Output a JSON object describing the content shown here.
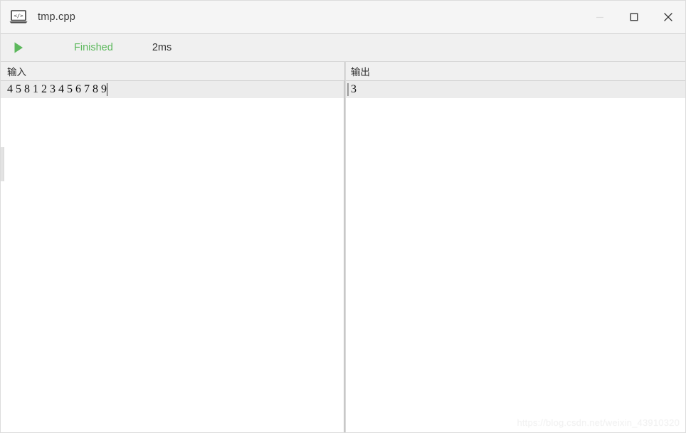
{
  "window": {
    "title": "tmp.cpp",
    "icon": "laptop-code-icon",
    "controls": {
      "minimize": "minimize-icon",
      "maximize": "maximize-icon",
      "close": "close-icon"
    }
  },
  "toolbar": {
    "run_icon": "play-icon",
    "status": "Finished",
    "elapsed": "2ms",
    "status_color": "#5cb85c",
    "elapsed_color": "#333333"
  },
  "panes": {
    "input": {
      "header": "输入",
      "lines": [
        "4 5 8 1 2 3 4 5 6 7 8 9"
      ]
    },
    "output": {
      "header": "输出",
      "lines": [
        "3"
      ]
    }
  },
  "watermark": "https://blog.csdn.net/weixin_43910320"
}
